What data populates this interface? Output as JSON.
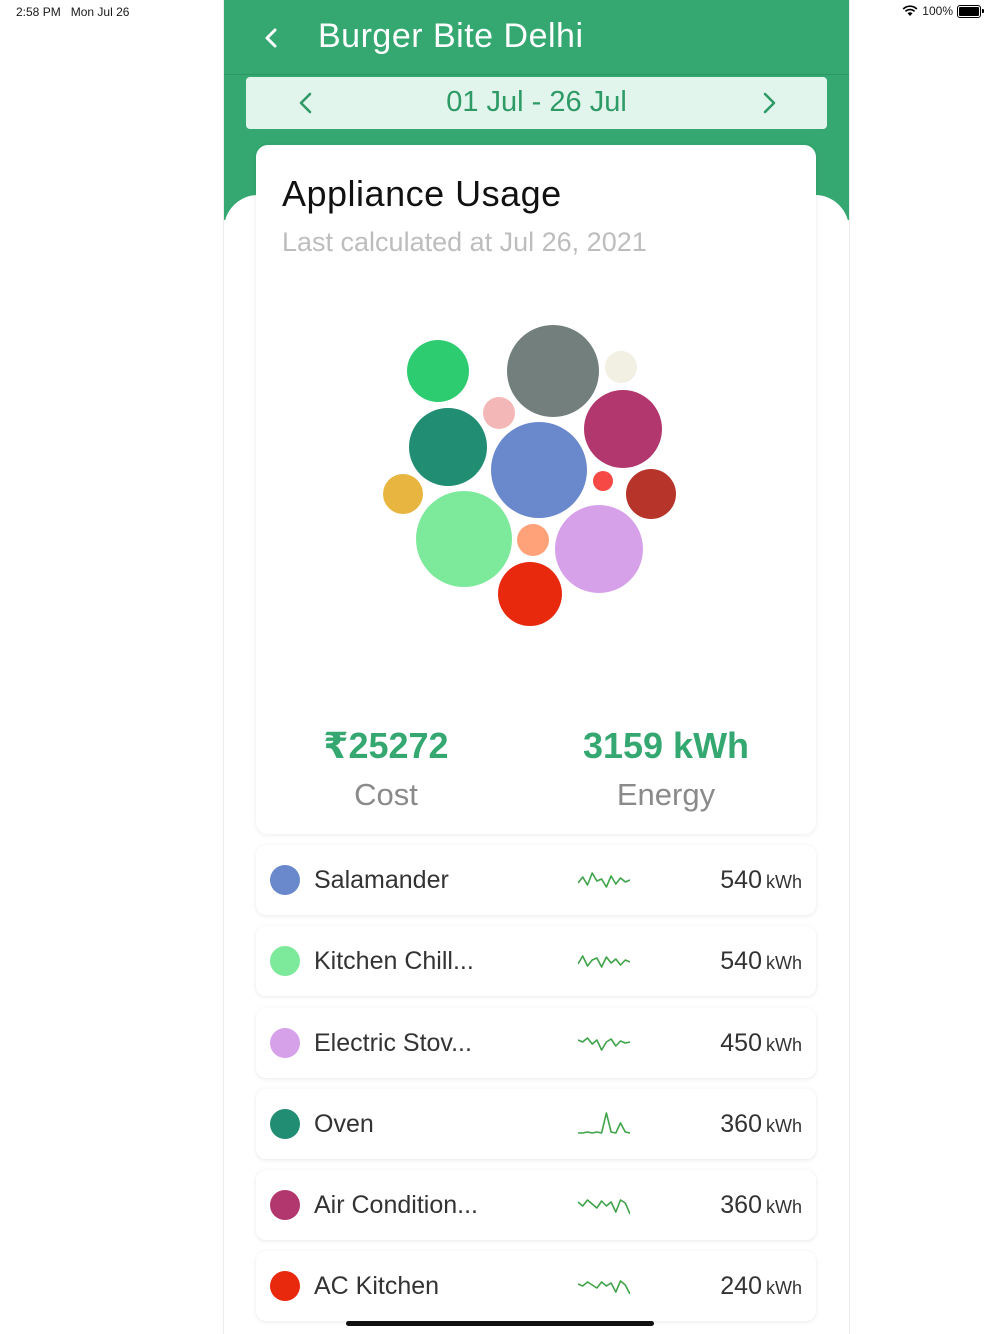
{
  "status": {
    "time": "2:58 PM",
    "date": "Mon Jul 26",
    "battery": "100%"
  },
  "header": {
    "title": "Burger Bite Delhi",
    "back_icon": "chevron-left-icon"
  },
  "date_range": {
    "label": "01 Jul - 26 Jul",
    "prev_icon": "chevron-left-icon",
    "next_icon": "chevron-right-icon"
  },
  "card": {
    "title": "Appliance Usage",
    "subtitle": "Last calculated at Jul 26, 2021",
    "cost": {
      "value": "₹25272",
      "label": "Cost"
    },
    "energy": {
      "value": "3159 kWh",
      "label": "Energy"
    }
  },
  "bubble_colors": [
    "#6a88cc",
    "#7de99b",
    "#d7a1ea",
    "#218d73",
    "#b2376f",
    "#e8290d",
    "#727f7d",
    "#2ecc71",
    "#b7342a",
    "#e8b640",
    "#f3b7b8",
    "#ffa27a",
    "#f2efe3",
    "#f64844"
  ],
  "appliances": [
    {
      "name": "Salamander",
      "value": "540",
      "unit": "kWh",
      "color": "#6a88cc",
      "spark": [
        8,
        14,
        6,
        18,
        10,
        12,
        4,
        15,
        7,
        13,
        9,
        11
      ]
    },
    {
      "name": "Kitchen Chill...",
      "value": "540",
      "unit": "kWh",
      "color": "#7de99b",
      "spark": [
        8,
        16,
        6,
        12,
        14,
        5,
        15,
        9,
        13,
        7,
        12,
        10
      ]
    },
    {
      "name": "Electric Stov...",
      "value": "450",
      "unit": "kWh",
      "color": "#d7a1ea",
      "spark": [
        14,
        12,
        16,
        10,
        14,
        4,
        12,
        15,
        8,
        13,
        11,
        12
      ]
    },
    {
      "name": "Oven",
      "value": "360",
      "unit": "kWh",
      "color": "#218d73",
      "spark": [
        2,
        2,
        3,
        2,
        3,
        2,
        22,
        3,
        2,
        12,
        3,
        2
      ]
    },
    {
      "name": "Air Condition...",
      "value": "360",
      "unit": "kWh",
      "color": "#b2376f",
      "spark": [
        14,
        10,
        16,
        12,
        8,
        15,
        10,
        14,
        4,
        16,
        13,
        2
      ]
    },
    {
      "name": "AC Kitchen",
      "value": "240",
      "unit": "kWh",
      "color": "#e8290d",
      "spark": [
        13,
        11,
        15,
        12,
        9,
        15,
        11,
        14,
        5,
        16,
        12,
        3
      ]
    }
  ]
}
